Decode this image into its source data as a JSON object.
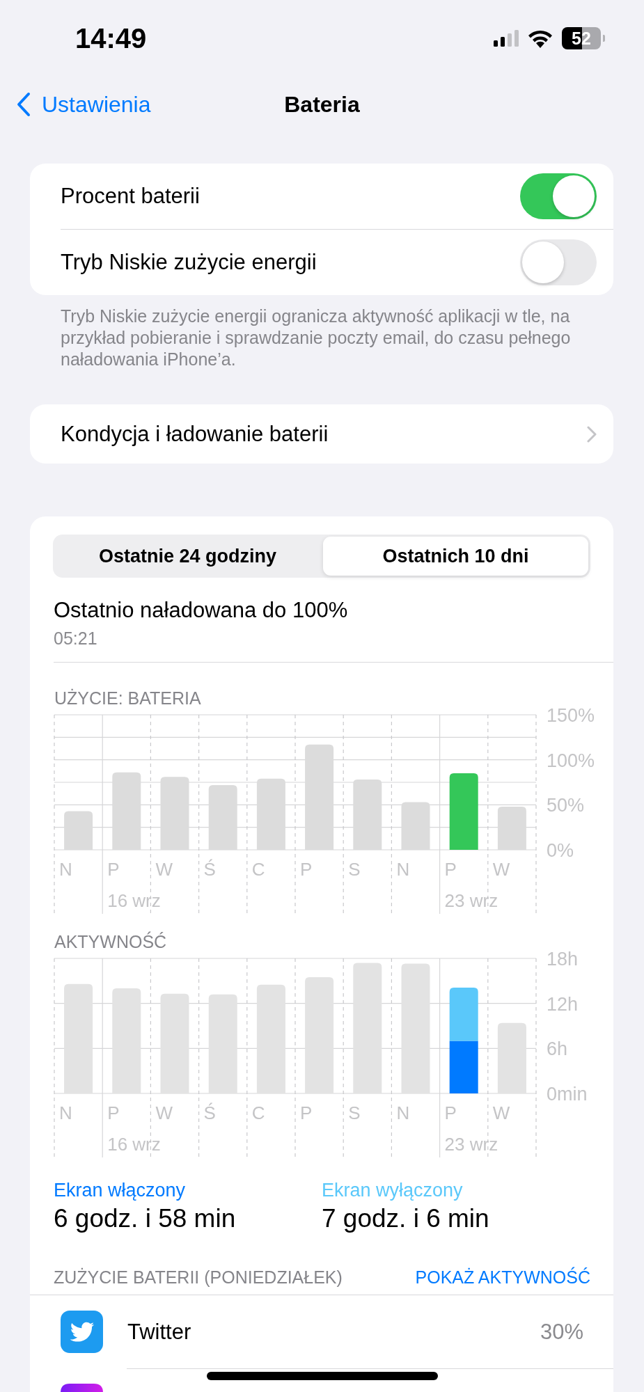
{
  "status_bar": {
    "time": "14:49",
    "battery": "52"
  },
  "nav": {
    "back": "Ustawienia",
    "title": "Bateria"
  },
  "toggles": [
    {
      "label": "Procent baterii",
      "on": true
    },
    {
      "label": "Tryb Niskie zużycie energii",
      "on": false
    }
  ],
  "toggles_footer": "Tryb Niskie zużycie energii ogranicza aktywność aplikacji w tle, na przykład pobieranie i sprawdzanie poczty email, do czasu pełnego naładowania iPhone’a.",
  "health_row": {
    "label": "Kondycja i ładowanie baterii"
  },
  "segments": [
    {
      "label": "Ostatnie 24 godziny",
      "selected": false
    },
    {
      "label": "Ostatnich 10 dni",
      "selected": true
    }
  ],
  "last_charge": {
    "title": "Ostatnio naładowana do 100%",
    "time": "05:21"
  },
  "usage_chart": {
    "chart_data": {
      "type": "bar",
      "title": "UŻYCIE: BATERIA",
      "stacked": true,
      "categories": [
        "N",
        "P",
        "W",
        "Ś",
        "C",
        "P",
        "S",
        "N",
        "P",
        "W"
      ],
      "ylim": [
        0,
        150
      ],
      "yticks": [
        {
          "value": 0,
          "label": "0%"
        },
        {
          "value": 50,
          "label": "50%"
        },
        {
          "value": 100,
          "label": "100%"
        },
        {
          "value": 150,
          "label": "150%"
        }
      ],
      "series": [
        {
          "color": "#dcdcdc",
          "values": [
            43,
            86,
            81,
            72,
            79,
            117,
            78,
            53,
            null,
            48
          ]
        },
        {
          "color": "#34c759",
          "values": [
            null,
            null,
            null,
            null,
            null,
            null,
            null,
            null,
            85,
            null
          ]
        }
      ],
      "annotations": [
        "16 wrz",
        "23 wrz"
      ]
    }
  },
  "activity_chart": {
    "chart_data": {
      "type": "bar",
      "title": "AKTYWNOŚĆ",
      "stacked": true,
      "categories": [
        "N",
        "P",
        "W",
        "Ś",
        "C",
        "P",
        "S",
        "N",
        "P",
        "W"
      ],
      "ylim": [
        0,
        18
      ],
      "yticks": [
        {
          "value": 0,
          "label": "0min"
        },
        {
          "value": 6,
          "label": "6h"
        },
        {
          "value": 12,
          "label": "12h"
        },
        {
          "value": 18,
          "label": "18h"
        }
      ],
      "series": [
        {
          "color": "#e3e3e3",
          "values": [
            14.6,
            14.0,
            13.3,
            13.2,
            14.5,
            15.5,
            17.4,
            17.3,
            null,
            9.4
          ]
        },
        {
          "name": "Ekran włączony",
          "color": "#007aff",
          "values": [
            null,
            null,
            null,
            null,
            null,
            null,
            null,
            null,
            7,
            null
          ]
        },
        {
          "name": "Ekran wyłączony",
          "color": "#5ac8fa",
          "values": [
            null,
            null,
            null,
            null,
            null,
            null,
            null,
            null,
            7.1,
            null
          ]
        }
      ],
      "annotations": [
        "16 wrz",
        "23 wrz"
      ]
    }
  },
  "screen_time": [
    {
      "value": "6 godz. i 58 min"
    },
    {
      "value": "7 godz. i 6 min"
    }
  ],
  "app_usage": {
    "header": "ZUŻYCIE BATERII (PONIEDZIAŁEK)",
    "action": "POKAŻ AKTYWNOŚĆ",
    "apps": [
      {
        "kind": "full",
        "name": "Twitter",
        "share": "30%"
      },
      {
        "kind": "cut"
      }
    ]
  }
}
